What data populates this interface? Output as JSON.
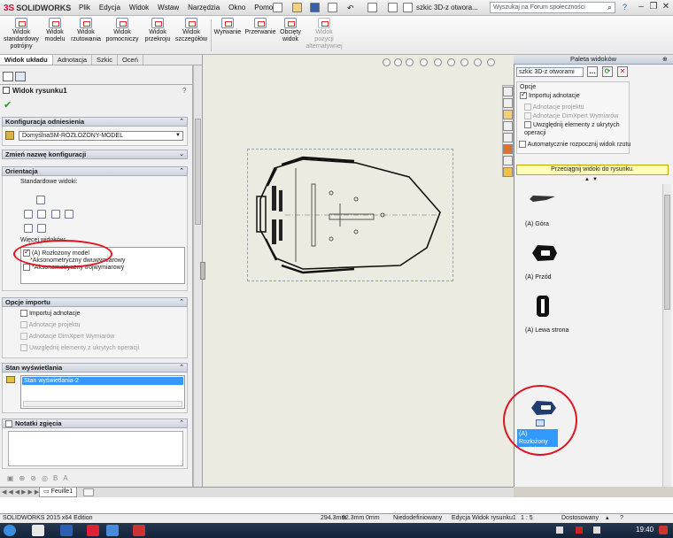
{
  "app": {
    "logo": "SOLIDWORKS",
    "logo_mark": "3S",
    "document_title": "szkic 3D-z otwora...",
    "search_placeholder": "Wyszukaj na Forum społeczności"
  },
  "menu": [
    "Plik",
    "Edycja",
    "Widok",
    "Wstaw",
    "Narzędzia",
    "Okno",
    "Pomoc"
  ],
  "commands": [
    {
      "label1": "Widok",
      "label2": "standardowy",
      "label3": "potrójny",
      "enabled": true
    },
    {
      "label1": "Widok",
      "label2": "modelu",
      "label3": "",
      "enabled": true
    },
    {
      "label1": "Widok",
      "label2": "rzutowania",
      "label3": "",
      "enabled": true
    },
    {
      "label1": "Widok",
      "label2": "pomocniczy",
      "label3": "",
      "enabled": true
    },
    {
      "label1": "Widok",
      "label2": "przekroju",
      "label3": "",
      "enabled": true
    },
    {
      "label1": "Widok",
      "label2": "szczegółów",
      "label3": "",
      "enabled": true
    },
    {
      "label1": "Wyrwanie",
      "label2": "",
      "label3": "",
      "enabled": true
    },
    {
      "label1": "Przerwanie",
      "label2": "",
      "label3": "",
      "enabled": true
    },
    {
      "label1": "Obcięty",
      "label2": "widok",
      "label3": "",
      "enabled": true
    },
    {
      "label1": "Widok",
      "label2": "pozycji",
      "label3": "alternatywnej",
      "enabled": false
    }
  ],
  "tabs": [
    "Widok układu",
    "Adnotacja",
    "Szkic",
    "Oceń"
  ],
  "property_manager": {
    "title": "Widok rysunku1",
    "help": "?",
    "sections": {
      "config": {
        "title": "Konfiguracja odniesienia",
        "value": "DomyślnaSM-ROZŁOŻONY-MODEL"
      },
      "rename": {
        "title": "Zmień nazwę konfiguracji"
      },
      "orientation": {
        "title": "Orientacja",
        "std_views_label": "Standardowe widoki:",
        "more_views_label": "Więcej widoków:",
        "items": [
          {
            "label": "(A) Rozłożony model",
            "checked": true
          },
          {
            "label": "*Aksonometryczny dwuwymiarowy",
            "checked": false
          },
          {
            "label": "*Aksonometryczny trójwymiarowy",
            "checked": false
          }
        ]
      },
      "import": {
        "title": "Opcje importu",
        "items": [
          {
            "label": "Importuj adnotacje",
            "enabled": true
          },
          {
            "label": "Adnotacje projektu",
            "enabled": false
          },
          {
            "label": "Adnotacje DimXpert Wymiarów",
            "enabled": false
          },
          {
            "label": "Uwzględnij elementy z ukrytych operacji",
            "enabled": false
          }
        ]
      },
      "display": {
        "title": "Stan wyświetlania",
        "value": "Stan wyświetlania-2"
      },
      "notes": {
        "title": "Notatki zgięcia"
      }
    }
  },
  "palette": {
    "title": "Paleta widoków",
    "select": "szkic 3D-z otworami",
    "options_label": "Opcje",
    "options": [
      {
        "label": "Importuj adnotacje",
        "checked": true,
        "enabled": true
      },
      {
        "label": "Adnotacje projektu",
        "checked": false,
        "enabled": false
      },
      {
        "label": "Adnotacje DimXpert Wymiarów",
        "checked": false,
        "enabled": false
      },
      {
        "label": "Uwzględnij elementy z ukrytych operacji",
        "checked": false,
        "enabled": true
      }
    ],
    "auto_start": "Automatycznie rozpocznij widok rzutu",
    "drag_hint": "Przeciągnij widoki do rysunku.",
    "views": [
      {
        "label": "(A) Góra"
      },
      {
        "label": "(A) Przód"
      },
      {
        "label": "(A) Lewa strona"
      },
      {
        "label": "(A) Rozłożony model"
      }
    ]
  },
  "sheet_tab": "Feuille1",
  "status": {
    "edition": "SOLIDWORKS 2015 x64 Edition",
    "x": "294.3mm",
    "y": "92.3mm",
    "z": "0mm",
    "state": "Niedodefiniowany",
    "editing": "Edycja Widok rysunku1",
    "scale": "1 : 5",
    "units": "Dostosowany",
    "help": "?"
  },
  "taskbar": {
    "time": "19:40"
  },
  "colors": {
    "selection": "#3399ff",
    "annotation_circle": "#e0141e",
    "hint_bg": "#ffffb7"
  }
}
